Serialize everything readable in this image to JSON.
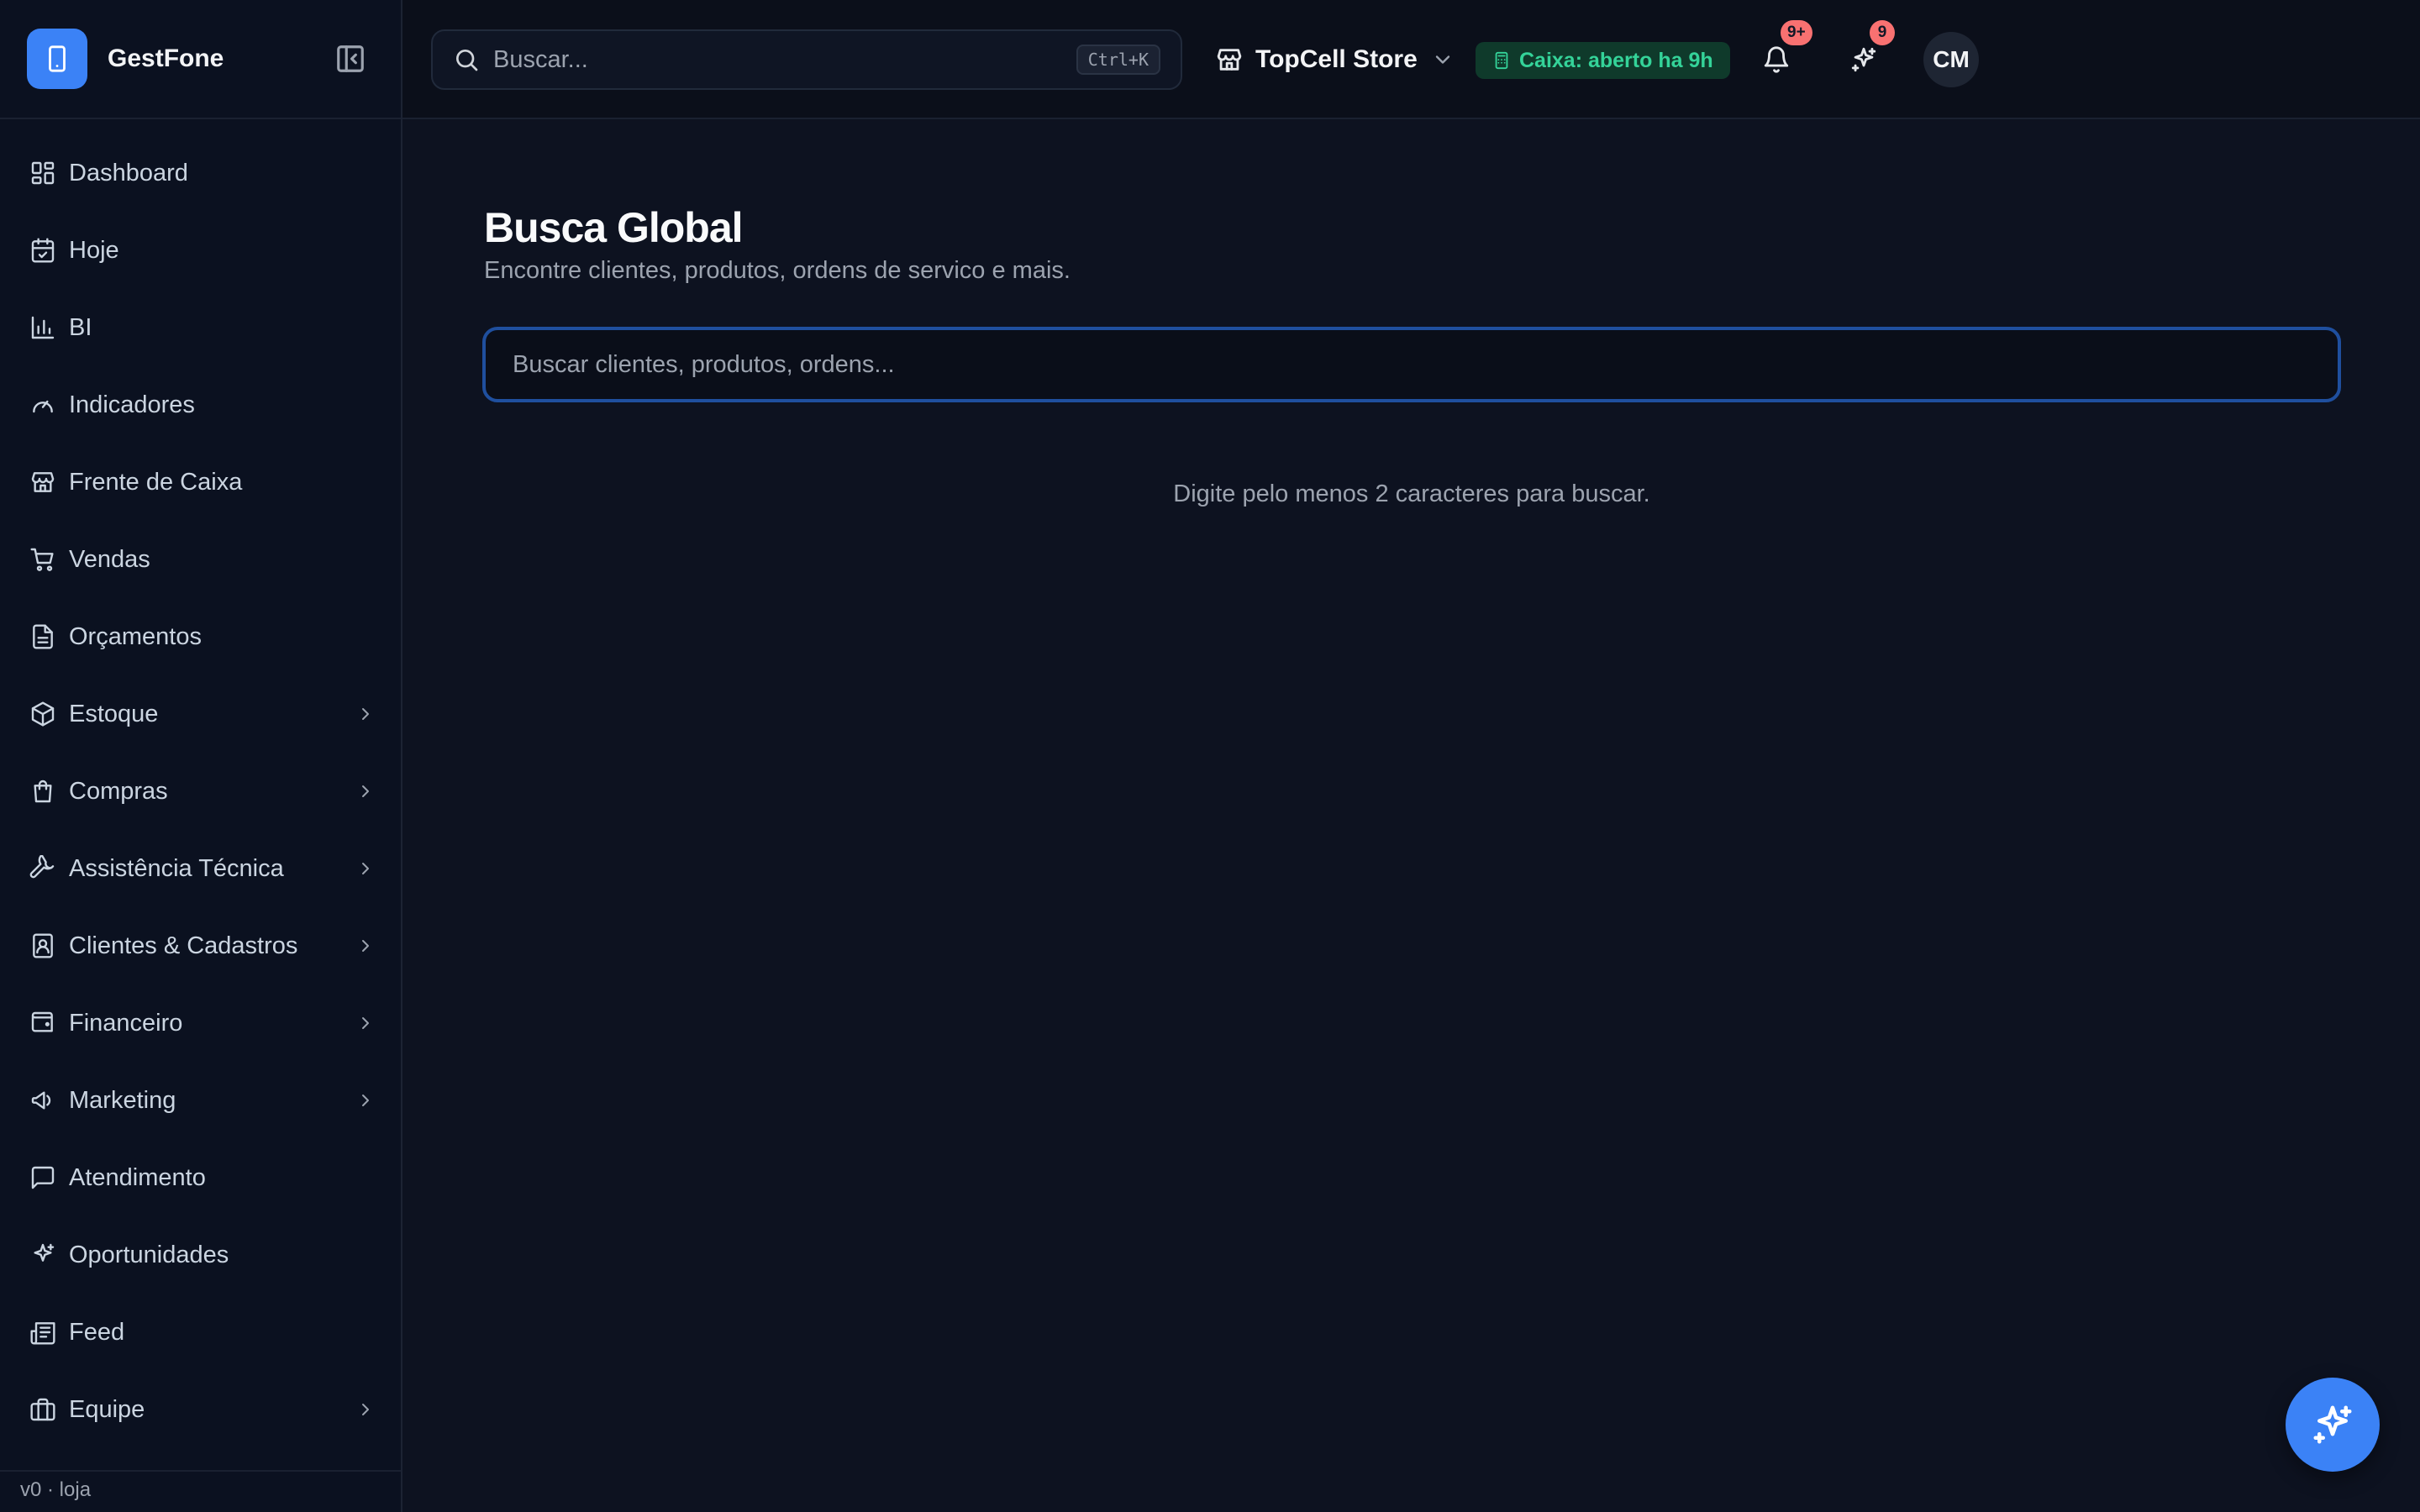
{
  "brand": {
    "name": "GestFone"
  },
  "sidebar": {
    "items": [
      {
        "label": "Dashboard",
        "icon": "dashboard-icon",
        "has_submenu": false
      },
      {
        "label": "Hoje",
        "icon": "calendar-check-icon",
        "has_submenu": false
      },
      {
        "label": "BI",
        "icon": "bar-chart-icon",
        "has_submenu": false
      },
      {
        "label": "Indicadores",
        "icon": "gauge-icon",
        "has_submenu": false
      },
      {
        "label": "Frente de Caixa",
        "icon": "store-icon",
        "has_submenu": false
      },
      {
        "label": "Vendas",
        "icon": "cart-icon",
        "has_submenu": false
      },
      {
        "label": "Orçamentos",
        "icon": "file-text-icon",
        "has_submenu": false
      },
      {
        "label": "Estoque",
        "icon": "package-icon",
        "has_submenu": true
      },
      {
        "label": "Compras",
        "icon": "shopping-bag-icon",
        "has_submenu": true
      },
      {
        "label": "Assistência Técnica",
        "icon": "wrench-icon",
        "has_submenu": true
      },
      {
        "label": "Clientes & Cadastros",
        "icon": "contact-book-icon",
        "has_submenu": true
      },
      {
        "label": "Financeiro",
        "icon": "wallet-icon",
        "has_submenu": true
      },
      {
        "label": "Marketing",
        "icon": "megaphone-icon",
        "has_submenu": true
      },
      {
        "label": "Atendimento",
        "icon": "message-icon",
        "has_submenu": false
      },
      {
        "label": "Oportunidades",
        "icon": "sparkles-icon",
        "has_submenu": false
      },
      {
        "label": "Feed",
        "icon": "newspaper-icon",
        "has_submenu": false
      },
      {
        "label": "Equipe",
        "icon": "briefcase-icon",
        "has_submenu": true
      }
    ],
    "version": "v0 · loja"
  },
  "topbar": {
    "search_placeholder": "Buscar...",
    "search_shortcut": "Ctrl+K",
    "store_name": "TopCell Store",
    "caixa_status": "Caixa: aberto ha 9h",
    "notifications_badge": "9+",
    "ai_badge": "9",
    "avatar_initials": "CM"
  },
  "main": {
    "title": "Busca Global",
    "subtitle": "Encontre clientes, produtos, ordens de servico e mais.",
    "search_placeholder": "Buscar clientes, produtos, ordens...",
    "hint": "Digite pelo menos 2 caracteres para buscar."
  },
  "colors": {
    "accent": "#3b82f6",
    "background": "#0d1220",
    "sidebar": "#0b1120",
    "success": "#34d399",
    "badge": "#f87171"
  }
}
